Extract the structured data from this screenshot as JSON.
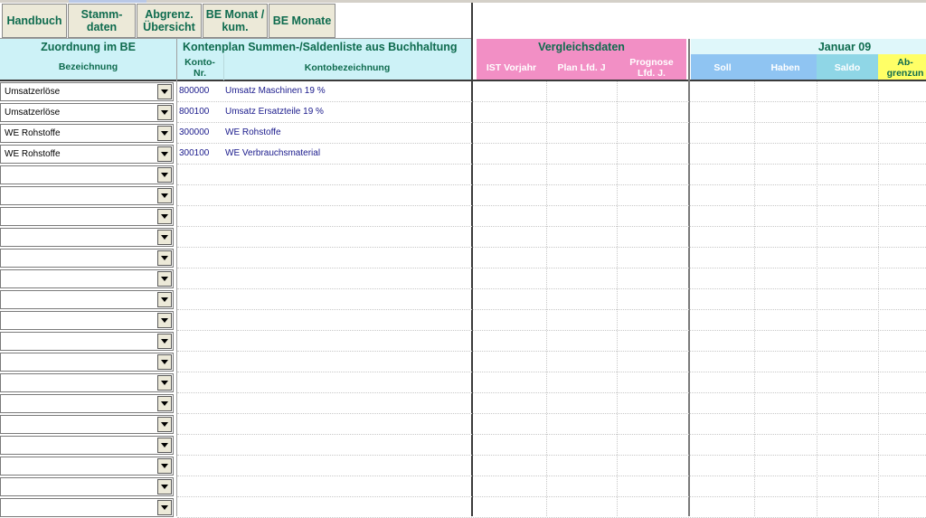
{
  "nav": {
    "handbuch": "Handbuch",
    "stammdaten_l1": "Stamm-",
    "stammdaten_l2": "daten",
    "abgrenz_l1": "Abgrenz.",
    "abgrenz_l2": "Übersicht",
    "bemonat_l1": "BE Monat /",
    "bemonat_l2": "kum.",
    "bemonate": "BE Monate"
  },
  "headers": {
    "zuordnung": "Zuordnung im BE",
    "bezeichnung": "Bezeichnung",
    "kontenplan": "Kontenplan Summen-/Saldenliste aus Buchhaltung",
    "konto_nr_l1": "Konto-",
    "konto_nr_l2": "Nr.",
    "kontobezeichnung": "Kontobezeichnung",
    "vergleichsdaten": "Vergleichsdaten",
    "ist_vorjahr": "IST Vorjahr",
    "plan": "Plan Lfd. J",
    "prognose_l1": "Prognose",
    "prognose_l2": "Lfd. J.",
    "januar": "Januar 09",
    "soll": "Soll",
    "haben": "Haben",
    "saldo": "Saldo",
    "abgrenz_l1": "Ab-",
    "abgrenz_l2": "grenzun"
  },
  "rows": [
    {
      "zuordnung": "Umsatzerlöse",
      "konto": "800000",
      "bezeichnung": "Umsatz Maschinen 19 %"
    },
    {
      "zuordnung": "Umsatzerlöse",
      "konto": "800100",
      "bezeichnung": "Umsatz Ersatzteile 19 %"
    },
    {
      "zuordnung": "WE Rohstoffe",
      "konto": "300000",
      "bezeichnung": "WE Rohstoffe"
    },
    {
      "zuordnung": "WE Rohstoffe",
      "konto": "300100",
      "bezeichnung": "WE Verbrauchsmaterial"
    },
    {
      "zuordnung": "",
      "konto": "",
      "bezeichnung": ""
    },
    {
      "zuordnung": "",
      "konto": "",
      "bezeichnung": ""
    },
    {
      "zuordnung": "",
      "konto": "",
      "bezeichnung": ""
    },
    {
      "zuordnung": "",
      "konto": "",
      "bezeichnung": ""
    },
    {
      "zuordnung": "",
      "konto": "",
      "bezeichnung": ""
    },
    {
      "zuordnung": "",
      "konto": "",
      "bezeichnung": ""
    },
    {
      "zuordnung": "",
      "konto": "",
      "bezeichnung": ""
    },
    {
      "zuordnung": "",
      "konto": "",
      "bezeichnung": ""
    },
    {
      "zuordnung": "",
      "konto": "",
      "bezeichnung": ""
    },
    {
      "zuordnung": "",
      "konto": "",
      "bezeichnung": ""
    },
    {
      "zuordnung": "",
      "konto": "",
      "bezeichnung": ""
    },
    {
      "zuordnung": "",
      "konto": "",
      "bezeichnung": ""
    },
    {
      "zuordnung": "",
      "konto": "",
      "bezeichnung": ""
    },
    {
      "zuordnung": "",
      "konto": "",
      "bezeichnung": ""
    },
    {
      "zuordnung": "",
      "konto": "",
      "bezeichnung": ""
    },
    {
      "zuordnung": "",
      "konto": "",
      "bezeichnung": ""
    },
    {
      "zuordnung": "",
      "konto": "",
      "bezeichnung": ""
    }
  ],
  "colors": {
    "cyan": "#cdf2f7",
    "light_cyan": "#dff7fa",
    "pink": "#f28fc5",
    "blue": "#8fc4f2",
    "yellow": "#ffff66",
    "green_text": "#0e6b4e",
    "navy_text": "#1a1a8c"
  }
}
